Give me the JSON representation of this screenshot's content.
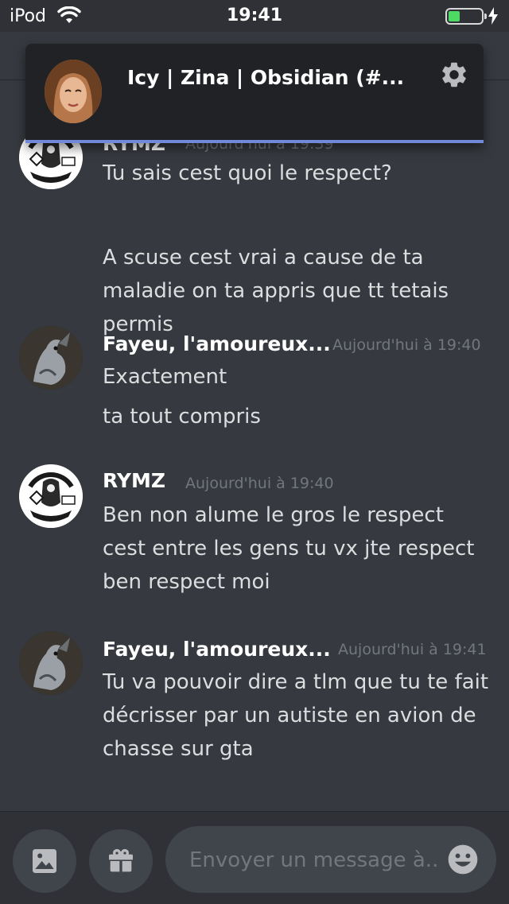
{
  "status_bar": {
    "carrier": "iPod",
    "time": "19:41"
  },
  "popup": {
    "channel_title": "Icy | Zina | Obsidian (#..."
  },
  "messages": [
    {
      "author": "RYMZ",
      "timestamp": "Aujourd'hui à 19:39",
      "avatar": "sons-of-anarchy-nomads-avatar",
      "lines": [
        "Tu sais cest quoi le respect?",
        "A scuse cest vrai a cause de ta maladie on ta appris que tt tetais permis"
      ]
    },
    {
      "author": "Fayeu, l'amoureux...",
      "timestamp": "Aujourd'hui à 19:40",
      "avatar": "dragon-avatar",
      "lines": [
        "Exactement",
        "ta tout compris"
      ]
    },
    {
      "author": "RYMZ",
      "timestamp": "Aujourd'hui à 19:40",
      "avatar": "sons-of-anarchy-nomads-avatar",
      "lines": [
        "Ben non alume le gros le respect cest entre les gens tu vx jte respect ben respect moi"
      ]
    },
    {
      "author": "Fayeu, l'amoureux...",
      "timestamp": "Aujourd'hui à 19:41",
      "avatar": "dragon-avatar",
      "lines": [
        "Tu va pouvoir dire a tlm que tu te fait décrisser par un autiste en avion de chasse sur gta"
      ]
    }
  ],
  "composer": {
    "placeholder": "Envoyer un message à.."
  },
  "colors": {
    "background": "#36393f",
    "accent": "#7289da",
    "timestamp": "#72767d",
    "battery": "#4cd964"
  }
}
